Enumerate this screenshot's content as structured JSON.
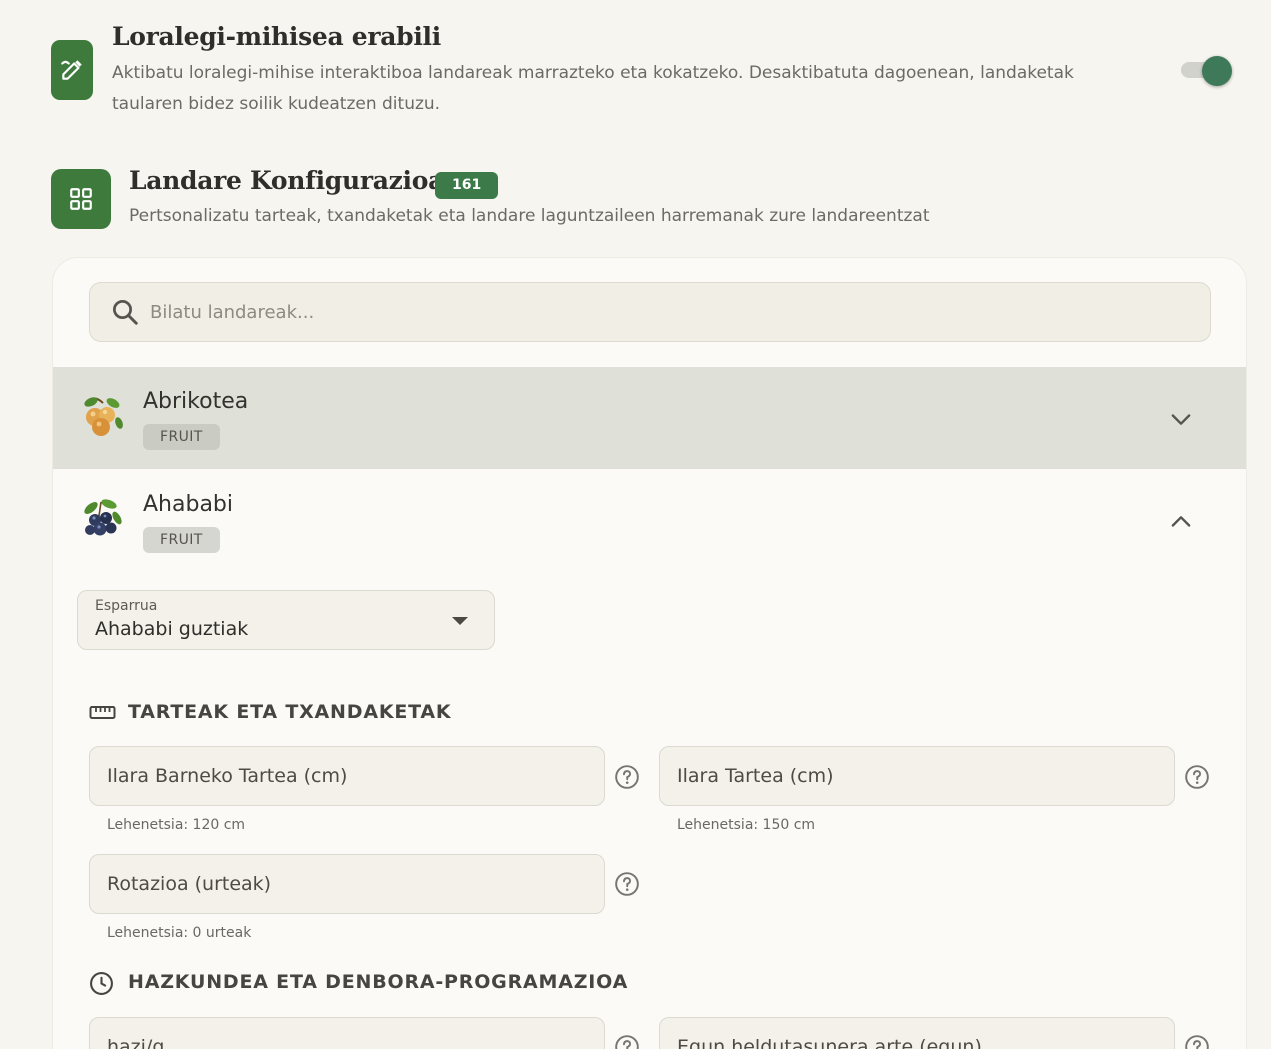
{
  "canvas_setting": {
    "title": "Loralegi-mihisea erabili",
    "description": "Aktibatu loralegi-mihise interaktiboa landareak marrazteko eta kokatzeko. Desaktibatuta dagoenean, landaketak taularen bidez soilik kudeatzen dituzu.",
    "enabled": true
  },
  "plant_config": {
    "title": "Landare Konfigurazioa",
    "count": "161",
    "description": "Pertsonalizatu tarteak, txandaketak eta landare laguntzaileen harremanak zure landareentzat"
  },
  "search": {
    "placeholder": "Bilatu landareak..."
  },
  "plants": [
    {
      "name": "Abrikotea",
      "tag": "FRUIT",
      "expanded": false
    },
    {
      "name": "Ahababi",
      "tag": "FRUIT",
      "expanded": true
    }
  ],
  "scope_select": {
    "label": "Esparrua",
    "value": "Ahababi guztiak"
  },
  "spacing_section": {
    "heading": "TARTEAK ETA TXANDAKETAK",
    "fields": [
      {
        "placeholder": "Ilara Barneko Tartea (cm)",
        "hint": "Lehenetsia: 120 cm"
      },
      {
        "placeholder": "Ilara Tartea (cm)",
        "hint": "Lehenetsia: 150 cm"
      },
      {
        "placeholder": "Rotazioa (urteak)",
        "hint": "Lehenetsia: 0 urteak"
      }
    ]
  },
  "growth_section": {
    "heading": "HAZKUNDEA ETA DENBORA-PROGRAMAZIOA",
    "fields": [
      {
        "placeholder": "hazi/g"
      },
      {
        "placeholder": "Egun heldutasunera arte (egun)"
      }
    ]
  },
  "colors": {
    "accent_green": "#3e7a3c",
    "badge_green": "#3c7a49",
    "toggle_knob": "#3e7a5a",
    "highlight_row": "#dfe0d8",
    "page_bg": "#f6f5f0"
  }
}
